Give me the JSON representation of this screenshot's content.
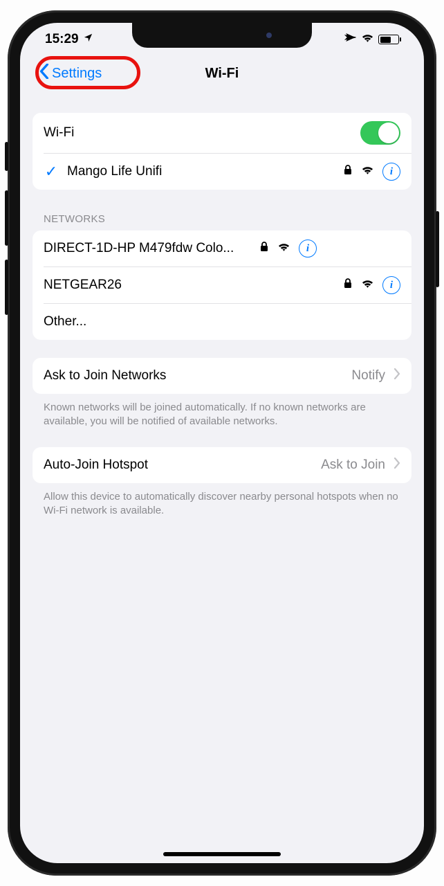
{
  "status": {
    "time": "15:29"
  },
  "nav": {
    "back": "Settings",
    "title": "Wi-Fi"
  },
  "wifi": {
    "toggle_label": "Wi-Fi",
    "connected": "Mango Life Unifi"
  },
  "networks": {
    "header": "NETWORKS",
    "list": [
      {
        "name": "DIRECT-1D-HP M479fdw Colo..."
      },
      {
        "name": "NETGEAR26"
      }
    ],
    "other": "Other..."
  },
  "ask_join": {
    "label": "Ask to Join Networks",
    "value": "Notify",
    "footer": "Known networks will be joined automatically. If no known networks are available, you will be notified of available networks."
  },
  "auto_hotspot": {
    "label": "Auto-Join Hotspot",
    "value": "Ask to Join",
    "footer": "Allow this device to automatically discover nearby personal hotspots when no Wi-Fi network is available."
  }
}
